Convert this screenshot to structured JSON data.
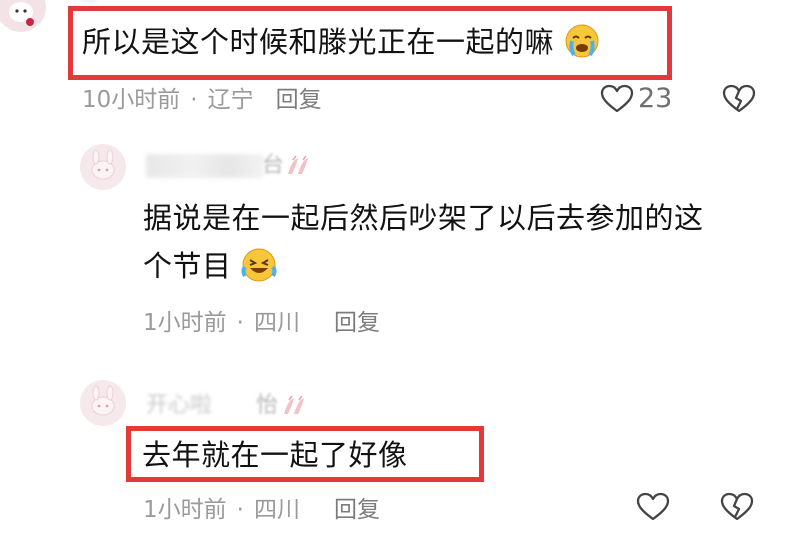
{
  "comments": [
    {
      "text": "所以是这个时候和滕光正在一起的嘛",
      "emoji": "crying-face",
      "time": "10小时前",
      "location": "辽宁",
      "reply_label": "回复",
      "likes": "23",
      "highlighted": true
    },
    {
      "name_visible_suffix": "台",
      "text_line1": "据说是在一起后然后吵架了以后去参加的这",
      "text_line2": "个节目",
      "emoji": "laughing-tears-face",
      "time": "1小时前",
      "location": "四川",
      "reply_label": "回复",
      "highlighted": false
    },
    {
      "name_visible_prefix": "开心啦",
      "name_visible_suffix": "怡",
      "text": "去年就在一起了好像",
      "time": "1小时前",
      "location": "四川",
      "reply_label": "回复",
      "highlighted": true
    }
  ],
  "separator": "·",
  "colors": {
    "highlight": "#e23a3a",
    "meta": "#9a9a9a",
    "text": "#121212"
  }
}
